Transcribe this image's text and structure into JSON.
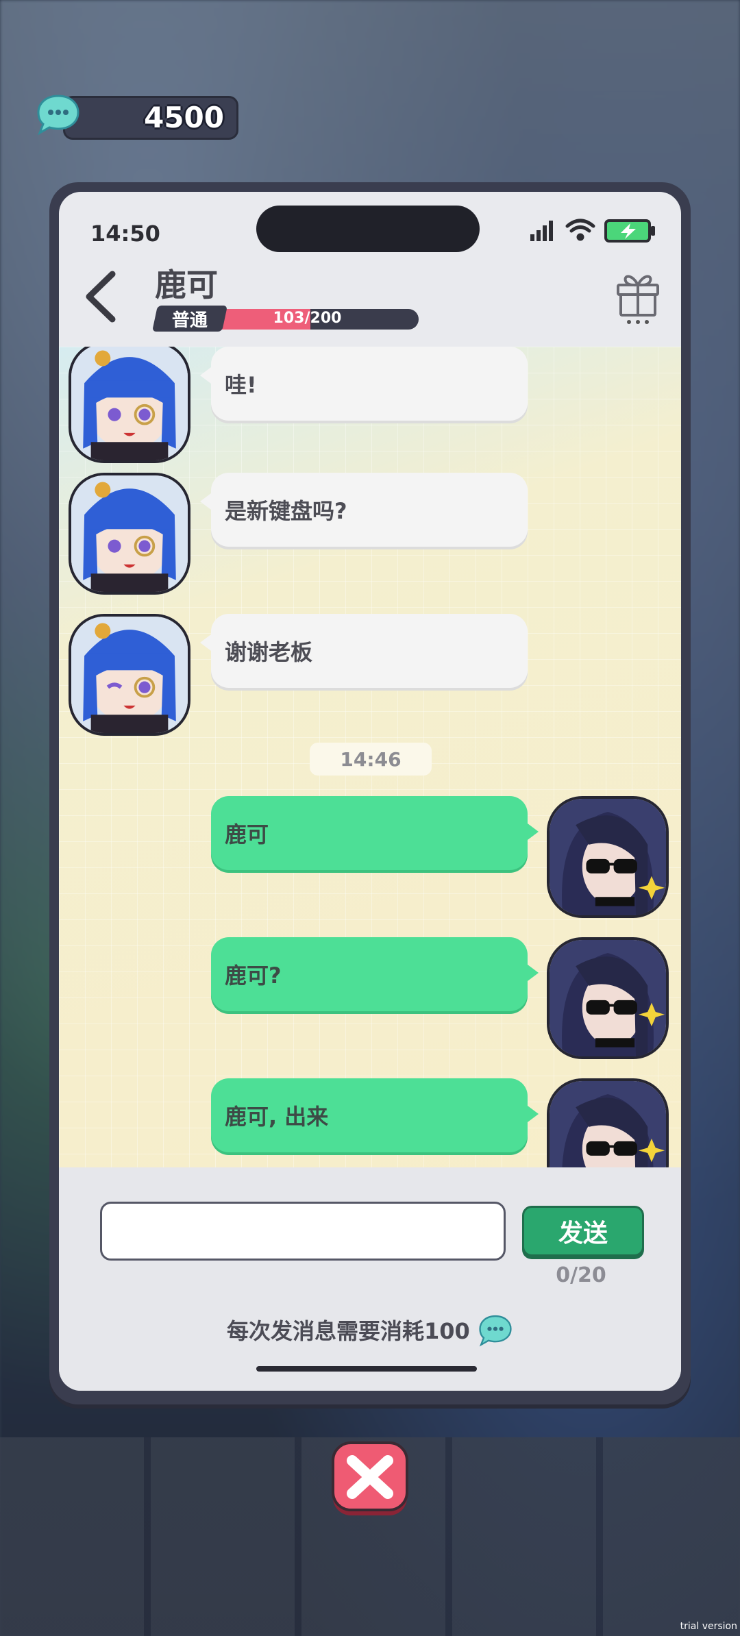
{
  "currency": {
    "value": "4500",
    "icon": "chat-bubble-coin-icon"
  },
  "status_bar": {
    "time": "14:50"
  },
  "header": {
    "name": "鹿可",
    "tier": "普通",
    "affinity_text": "103/200",
    "affinity_fraction": 0.515
  },
  "messages": [
    {
      "side": "in",
      "text": "哇!"
    },
    {
      "side": "in",
      "text": "是新键盘吗?"
    },
    {
      "side": "in",
      "text": "谢谢老板"
    },
    {
      "side": "time",
      "text": "14:46"
    },
    {
      "side": "out",
      "text": "鹿可"
    },
    {
      "side": "out",
      "text": "鹿可?"
    },
    {
      "side": "out",
      "text": "鹿可, 出来"
    }
  ],
  "composer": {
    "value": "",
    "send_label": "发送",
    "counter": "0/20",
    "cost_note": "每次发消息需要消耗100"
  },
  "colors": {
    "outgoing_bubble": "#4ddf96",
    "incoming_bubble": "#f4f4f4",
    "affinity_fill": "#ee5e79",
    "send_button": "#2aa76e",
    "close_button": "#ef5b73"
  },
  "watermark": "trial version"
}
